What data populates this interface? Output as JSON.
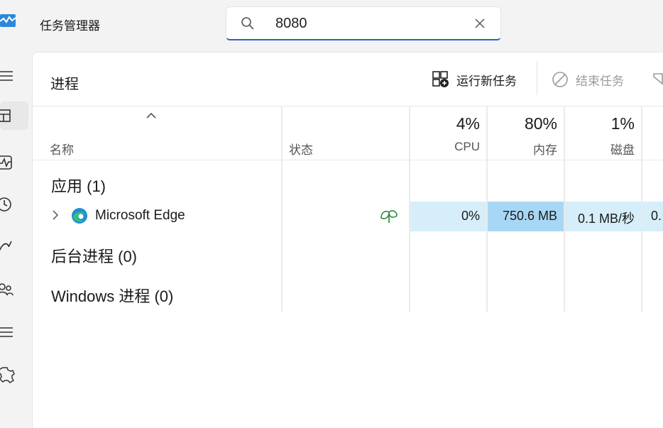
{
  "app": {
    "title": "任务管理器",
    "logo_icon": "task-manager-logo"
  },
  "search": {
    "value": "8080",
    "icon": "search-icon",
    "clear_icon": "close-icon"
  },
  "nav": {
    "items": [
      {
        "name": "hamburger-menu-icon"
      },
      {
        "name": "processes-icon"
      },
      {
        "name": "performance-icon"
      },
      {
        "name": "app-history-icon"
      },
      {
        "name": "startup-apps-icon"
      },
      {
        "name": "users-icon"
      },
      {
        "name": "details-icon"
      },
      {
        "name": "services-icon"
      }
    ]
  },
  "page": {
    "title": "进程"
  },
  "toolbar": {
    "run_new_task": "运行新任务",
    "end_task": "结束任务"
  },
  "columns": {
    "name": "名称",
    "status": "状态",
    "cpu": {
      "pct": "4%",
      "label": "CPU"
    },
    "memory": {
      "pct": "80%",
      "label": "内存"
    },
    "disk": {
      "pct": "1%",
      "label": "磁盘"
    }
  },
  "groups": {
    "apps": "应用 (1)",
    "background": "后台进程 (0)",
    "windows": "Windows 进程 (0)"
  },
  "rows": [
    {
      "name": "Microsoft Edge",
      "status_icon": "efficiency-mode-leaf-icon",
      "cpu": "0%",
      "memory": "750.6 MB",
      "disk": "0.1 MB/秒",
      "network": "0."
    }
  ],
  "colors": {
    "accent": "#2b63c4",
    "cell_light": "#d6eefa",
    "cell_strong": "#a8d7f5",
    "leaf": "#2e8b3d"
  }
}
